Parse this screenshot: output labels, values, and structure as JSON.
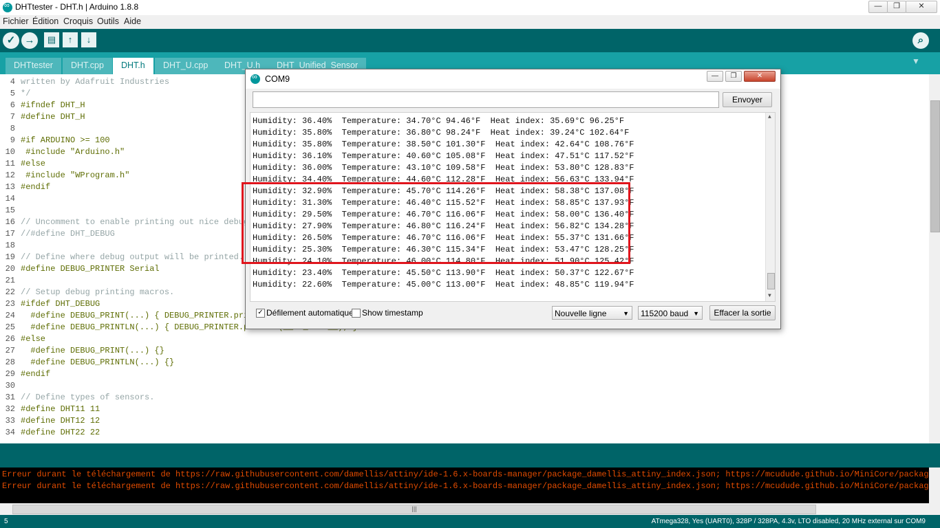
{
  "window": {
    "title": "DHTtester - DHT.h | Arduino 1.8.8",
    "controls": [
      "—",
      "❐",
      "✕"
    ]
  },
  "menu": [
    "Fichier",
    "Édition",
    "Croquis",
    "Outils",
    "Aide"
  ],
  "toolbar": {
    "verify": "✓",
    "upload": "→",
    "new": "▤",
    "open": "↑",
    "save": "↓",
    "serial_monitor": "⌕"
  },
  "tabs": [
    "DHTtester",
    "DHT.cpp",
    "DHT.h",
    "DHT_U.cpp",
    "DHT_U.h",
    "DHT_Unified_Sensor"
  ],
  "tab_menu": "▼",
  "editor": {
    "lines": [
      {
        "n": "4",
        "t": "written by Adafruit Industries"
      },
      {
        "n": "5",
        "t": "*/"
      },
      {
        "n": "6",
        "t": "#ifndef DHT_H"
      },
      {
        "n": "7",
        "t": "#define DHT_H"
      },
      {
        "n": "8",
        "t": ""
      },
      {
        "n": "9",
        "t": "#if ARDUINO >= 100"
      },
      {
        "n": "10",
        "t": " #include \"Arduino.h\""
      },
      {
        "n": "11",
        "t": "#else"
      },
      {
        "n": "12",
        "t": " #include \"WProgram.h\""
      },
      {
        "n": "13",
        "t": "#endif"
      },
      {
        "n": "14",
        "t": ""
      },
      {
        "n": "15",
        "t": ""
      },
      {
        "n": "16",
        "t": "// Uncomment to enable printing out nice debug"
      },
      {
        "n": "17",
        "t": "//#define DHT_DEBUG"
      },
      {
        "n": "18",
        "t": ""
      },
      {
        "n": "19",
        "t": "// Define where debug output will be printed."
      },
      {
        "n": "20",
        "t": "#define DEBUG_PRINTER Serial"
      },
      {
        "n": "21",
        "t": ""
      },
      {
        "n": "22",
        "t": "// Setup debug printing macros."
      },
      {
        "n": "23",
        "t": "#ifdef DHT_DEBUG"
      },
      {
        "n": "24",
        "t": "  #define DEBUG_PRINT(...) { DEBUG_PRINTER.print"
      },
      {
        "n": "25",
        "t": "  #define DEBUG_PRINTLN(...) { DEBUG_PRINTER.println(__VA_ARGS__); }"
      },
      {
        "n": "26",
        "t": "#else"
      },
      {
        "n": "27",
        "t": "  #define DEBUG_PRINT(...) {}"
      },
      {
        "n": "28",
        "t": "  #define DEBUG_PRINTLN(...) {}"
      },
      {
        "n": "29",
        "t": "#endif"
      },
      {
        "n": "30",
        "t": ""
      },
      {
        "n": "31",
        "t": "// Define types of sensors."
      },
      {
        "n": "32",
        "t": "#define DHT11 11"
      },
      {
        "n": "33",
        "t": "#define DHT12 12"
      },
      {
        "n": "34",
        "t": "#define DHT22 22"
      }
    ]
  },
  "console": {
    "errors": [
      "Erreur durant le téléchargement de https://raw.githubusercontent.com/damellis/attiny/ide-1.6.x-boards-manager/package_damellis_attiny_index.json; https://mcudude.github.io/MiniCore/package_MCUd",
      "Erreur durant le téléchargement de https://raw.githubusercontent.com/damellis/attiny/ide-1.6.x-boards-manager/package_damellis_attiny_index.json; https://mcudude.github.io/MiniCore/package_MCUd"
    ],
    "scroll_grip": "|||"
  },
  "status": {
    "line_number": "5",
    "board": "ATmega328, Yes (UART0), 328P / 328PA, 4.3v, LTO disabled, 20 MHz external sur COM9"
  },
  "serial_monitor": {
    "title": "COM9",
    "send_label": "Envoyer",
    "send_value": "",
    "lines": [
      "Humidity: 36.40%  Temperature: 34.70°C 94.46°F  Heat index: 35.69°C 96.25°F",
      "Humidity: 35.80%  Temperature: 36.80°C 98.24°F  Heat index: 39.24°C 102.64°F",
      "Humidity: 35.80%  Temperature: 38.50°C 101.30°F  Heat index: 42.64°C 108.76°F",
      "Humidity: 36.10%  Temperature: 40.60°C 105.08°F  Heat index: 47.51°C 117.52°F",
      "Humidity: 36.00%  Temperature: 43.10°C 109.58°F  Heat index: 53.80°C 128.83°F",
      "Humidity: 34.40%  Temperature: 44.60°C 112.28°F  Heat index: 56.63°C 133.94°F",
      "Humidity: 32.90%  Temperature: 45.70°C 114.26°F  Heat index: 58.38°C 137.08°F",
      "Humidity: 31.30%  Temperature: 46.40°C 115.52°F  Heat index: 58.85°C 137.93°F",
      "Humidity: 29.50%  Temperature: 46.70°C 116.06°F  Heat index: 58.00°C 136.40°F",
      "Humidity: 27.90%  Temperature: 46.80°C 116.24°F  Heat index: 56.82°C 134.28°F",
      "Humidity: 26.50%  Temperature: 46.70°C 116.06°F  Heat index: 55.37°C 131.66°F",
      "Humidity: 25.30%  Temperature: 46.30°C 115.34°F  Heat index: 53.47°C 128.25°F",
      "Humidity: 24.10%  Temperature: 46.00°C 114.80°F  Heat index: 51.90°C 125.42°F",
      "Humidity: 23.40%  Temperature: 45.50°C 113.90°F  Heat index: 50.37°C 122.67°F",
      "Humidity: 22.60%  Temperature: 45.00°C 113.00°F  Heat index: 48.85°C 119.94°F"
    ],
    "autoscroll_label": "Défilement automatique",
    "autoscroll_checked": "✓",
    "timestamp_label": "Show timestamp",
    "line_ending": "Nouvelle ligne",
    "baud": "115200 baud",
    "clear_label": "Effacer la sortie"
  },
  "colors": {
    "toolbar": "#006468",
    "tabbar": "#17a1a5",
    "highlight": "#e0141c",
    "error_text": "#e34c00"
  }
}
